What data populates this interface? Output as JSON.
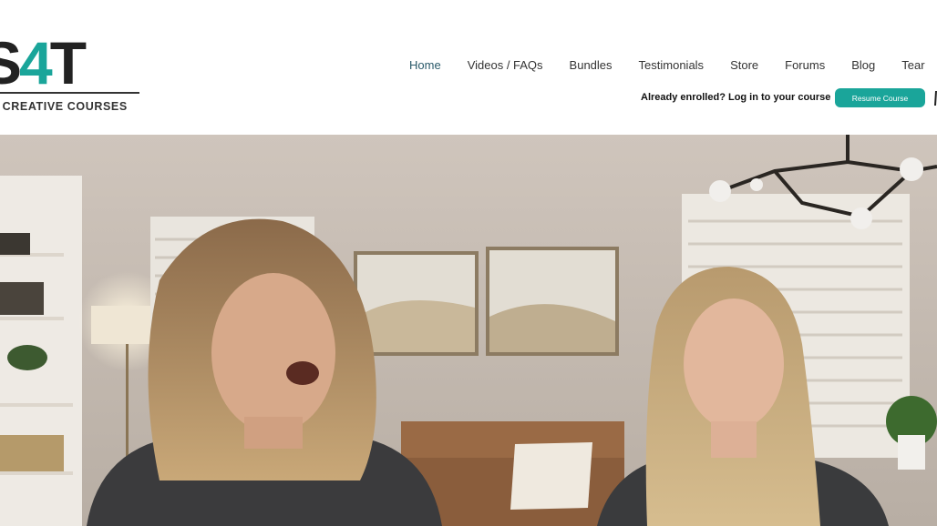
{
  "logo": {
    "mark_text": "S",
    "mark_accent": "4",
    "mark_end": "T",
    "subtitle": "ER CREATIVE COURSES"
  },
  "nav": {
    "items": [
      {
        "label": "Home",
        "active": true
      },
      {
        "label": "Videos / FAQs"
      },
      {
        "label": "Bundles"
      },
      {
        "label": "Testimonials"
      },
      {
        "label": "Store"
      },
      {
        "label": "Forums"
      },
      {
        "label": "Blog"
      },
      {
        "label": "Tear"
      }
    ]
  },
  "enrolled": {
    "text": "Already enrolled? Log in to your course",
    "button_label": "Resume Course"
  },
  "colors": {
    "accent": "#1aa59a",
    "text": "#333333"
  },
  "video": {
    "icon": "video-frame"
  }
}
